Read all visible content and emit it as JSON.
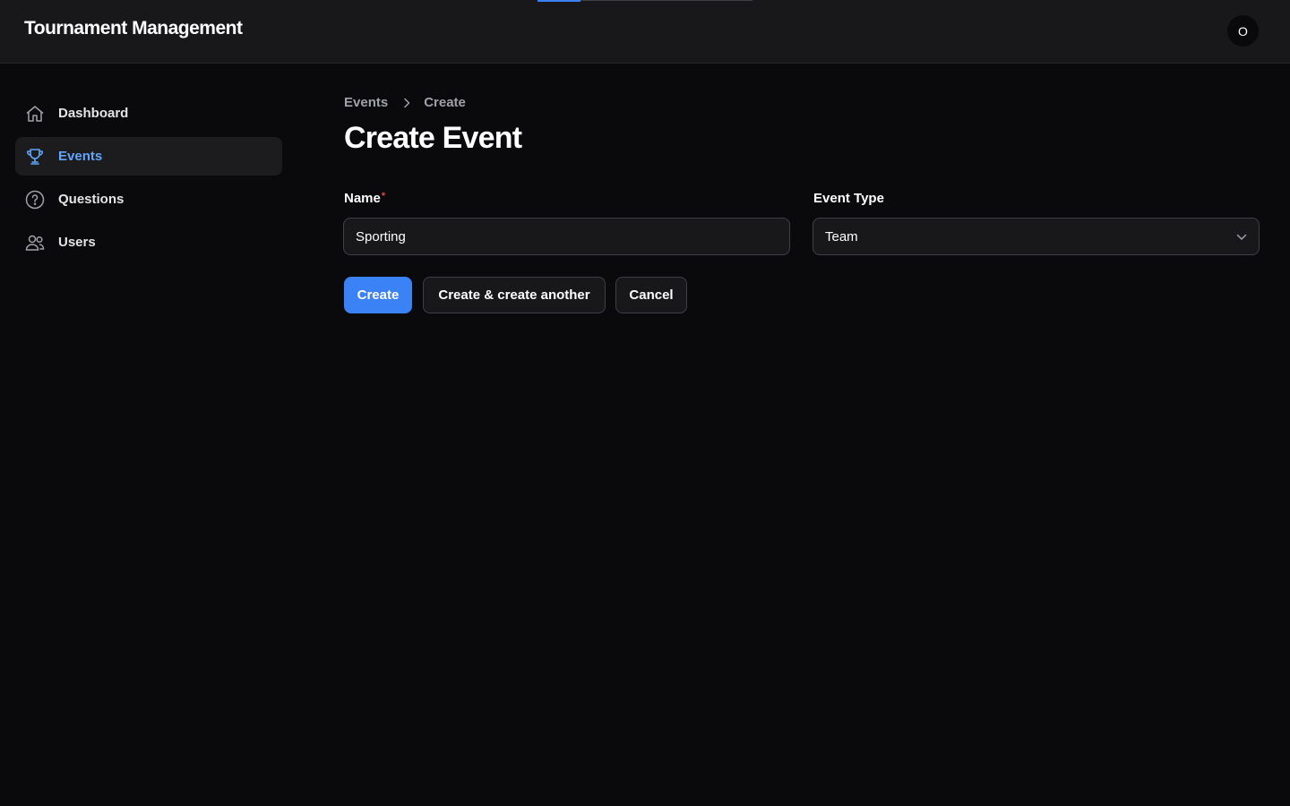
{
  "header": {
    "app_title": "Tournament Management",
    "avatar_initial": "O",
    "progress_fraction": 0.2
  },
  "sidebar": {
    "items": [
      {
        "label": "Dashboard",
        "icon": "home-icon",
        "active": false
      },
      {
        "label": "Events",
        "icon": "trophy-icon",
        "active": true
      },
      {
        "label": "Questions",
        "icon": "question-circle-icon",
        "active": false
      },
      {
        "label": "Users",
        "icon": "users-icon",
        "active": false
      }
    ]
  },
  "breadcrumb": {
    "parent": "Events",
    "current": "Create"
  },
  "page": {
    "title": "Create Event"
  },
  "form": {
    "name_label": "Name",
    "name_required_marker": "*",
    "name_value": "Sporting",
    "event_type_label": "Event Type",
    "event_type_value": "Team"
  },
  "actions": {
    "create": "Create",
    "create_another": "Create & create another",
    "cancel": "Cancel"
  },
  "colors": {
    "accent": "#3b82f6",
    "active_nav_text": "#60a5fa",
    "background": "#0a0a0c",
    "required": "#ef4444"
  }
}
